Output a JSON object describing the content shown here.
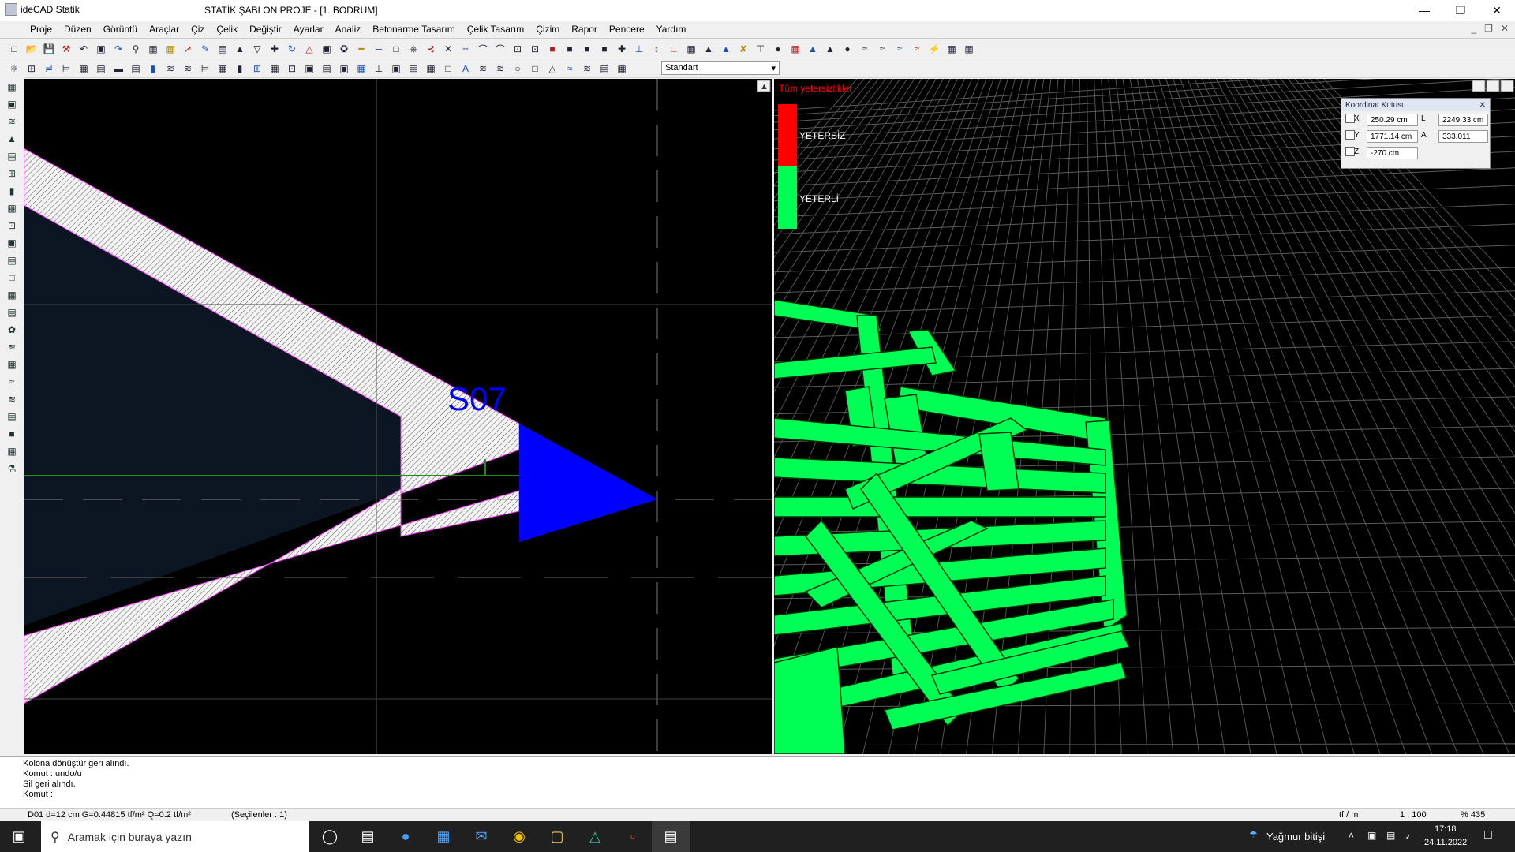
{
  "window": {
    "app_name": "ideCAD Statik",
    "title": "STATİK ŞABLON PROJE - [1. BODRUM]"
  },
  "menu": [
    "Proje",
    "Düzen",
    "Görüntü",
    "Araçlar",
    "Çiz",
    "Çelik",
    "Değiştir",
    "Ayarlar",
    "Analiz",
    "Betonarme Tasarım",
    "Çelik Tasarım",
    "Çizim",
    "Rapor",
    "Pencere",
    "Yardım"
  ],
  "toolbar": {
    "style_combo": "Standart"
  },
  "viewport2d": {
    "label": "S07"
  },
  "viewport3d": {
    "legend_title": "Tüm yetersizlikler",
    "legend": [
      {
        "label": "YETERSİZ",
        "color": "#ff0000"
      },
      {
        "label": "YETERLİ",
        "color": "#00ff55"
      }
    ]
  },
  "coord_box": {
    "title": "Koordinat Kutusu",
    "x_label": "X",
    "x": "250.29 cm",
    "y_label": "Y",
    "y": "1771.14 cm",
    "z_label": "Z",
    "z": "-270 cm",
    "l_label": "L",
    "l": "2249.33 cm",
    "a_label": "A",
    "a": "333.011"
  },
  "command_lines": [
    "Kolona dönüştür geri alındı.",
    "Komut : undo/u",
    "Sil geri alındı.",
    "Komut :"
  ],
  "status": {
    "left": "D01 d=12 cm G=0.44815 tf/m² Q=0.2 tf/m²",
    "selected": "(Seçilenler : 1)",
    "unit": "tf / m",
    "scale": "1 : 100",
    "zoom": "% 435"
  },
  "taskbar": {
    "search_placeholder": "Aramak için buraya yazın",
    "weather": "Yağmur bitişi",
    "time": "17:18",
    "date": "24.11.2022"
  }
}
